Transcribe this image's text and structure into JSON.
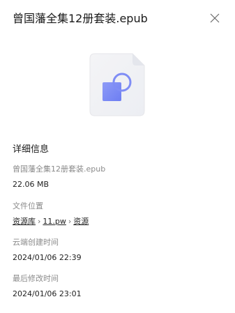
{
  "header": {
    "title": "曾国藩全集12册套装.epub",
    "close_icon": "close-icon"
  },
  "preview": {
    "icon": "file-preview-icon",
    "accent": "#7f8df5"
  },
  "details": {
    "section_title": "详细信息",
    "file_name": "曾国藩全集12册套装.epub",
    "file_size": "22.06 MB",
    "location_label": "文件位置",
    "location_path": [
      "资源库",
      "11.pw",
      "资源"
    ],
    "path_separator": "›",
    "created_label": "云端创建时间",
    "created_value": "2024/01/06 22:39",
    "modified_label": "最后修改时间",
    "modified_value": "2024/01/06 23:01"
  }
}
